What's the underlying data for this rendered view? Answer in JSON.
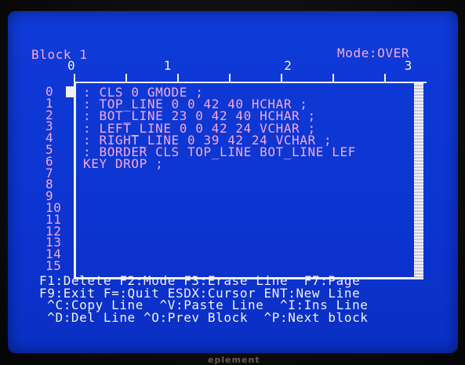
{
  "header": {
    "block_title": "Block 1",
    "mode": "Mode:OVER"
  },
  "ruler": {
    "labels": [
      "0",
      "1",
      "2",
      "3"
    ]
  },
  "editor": {
    "line_numbers": [
      "0",
      "1",
      "2",
      "3",
      "4",
      "5",
      "6",
      "7",
      "8",
      "9",
      "10",
      "11",
      "12",
      "13",
      "14",
      "15"
    ],
    "lines": [
      ": CLS 0 GMODE ;",
      ": TOP_LINE 0 0 42 40 HCHAR ;",
      ": BOT_LINE 23 0 42 40 HCHAR ;",
      ": LEFT_LINE 0 0 42 24 VCHAR ;",
      ": RIGHT_LINE 0 39 42 24 VCHAR ;",
      ": BORDER CLS TOP_LINE BOT_LINE LEF",
      "KEY DROP ;"
    ]
  },
  "help": {
    "lines": [
      "F1:Delete F2:Mode F3:Erase Line  F7:Page",
      "F9:Exit F=:Quit ESDX:Cursor ENT:New Line",
      " ^C:Copy Line  ^V:Paste Line  ^I:Ins Line",
      " ^D:Del Line ^O:Prev Block  ^P:Next block"
    ]
  },
  "bezel": {
    "brand": "eplement"
  },
  "colors": {
    "screen_blue": "#0f3bd8",
    "text_white": "#f0f0f8",
    "text_pink": "#f3a9e6"
  }
}
